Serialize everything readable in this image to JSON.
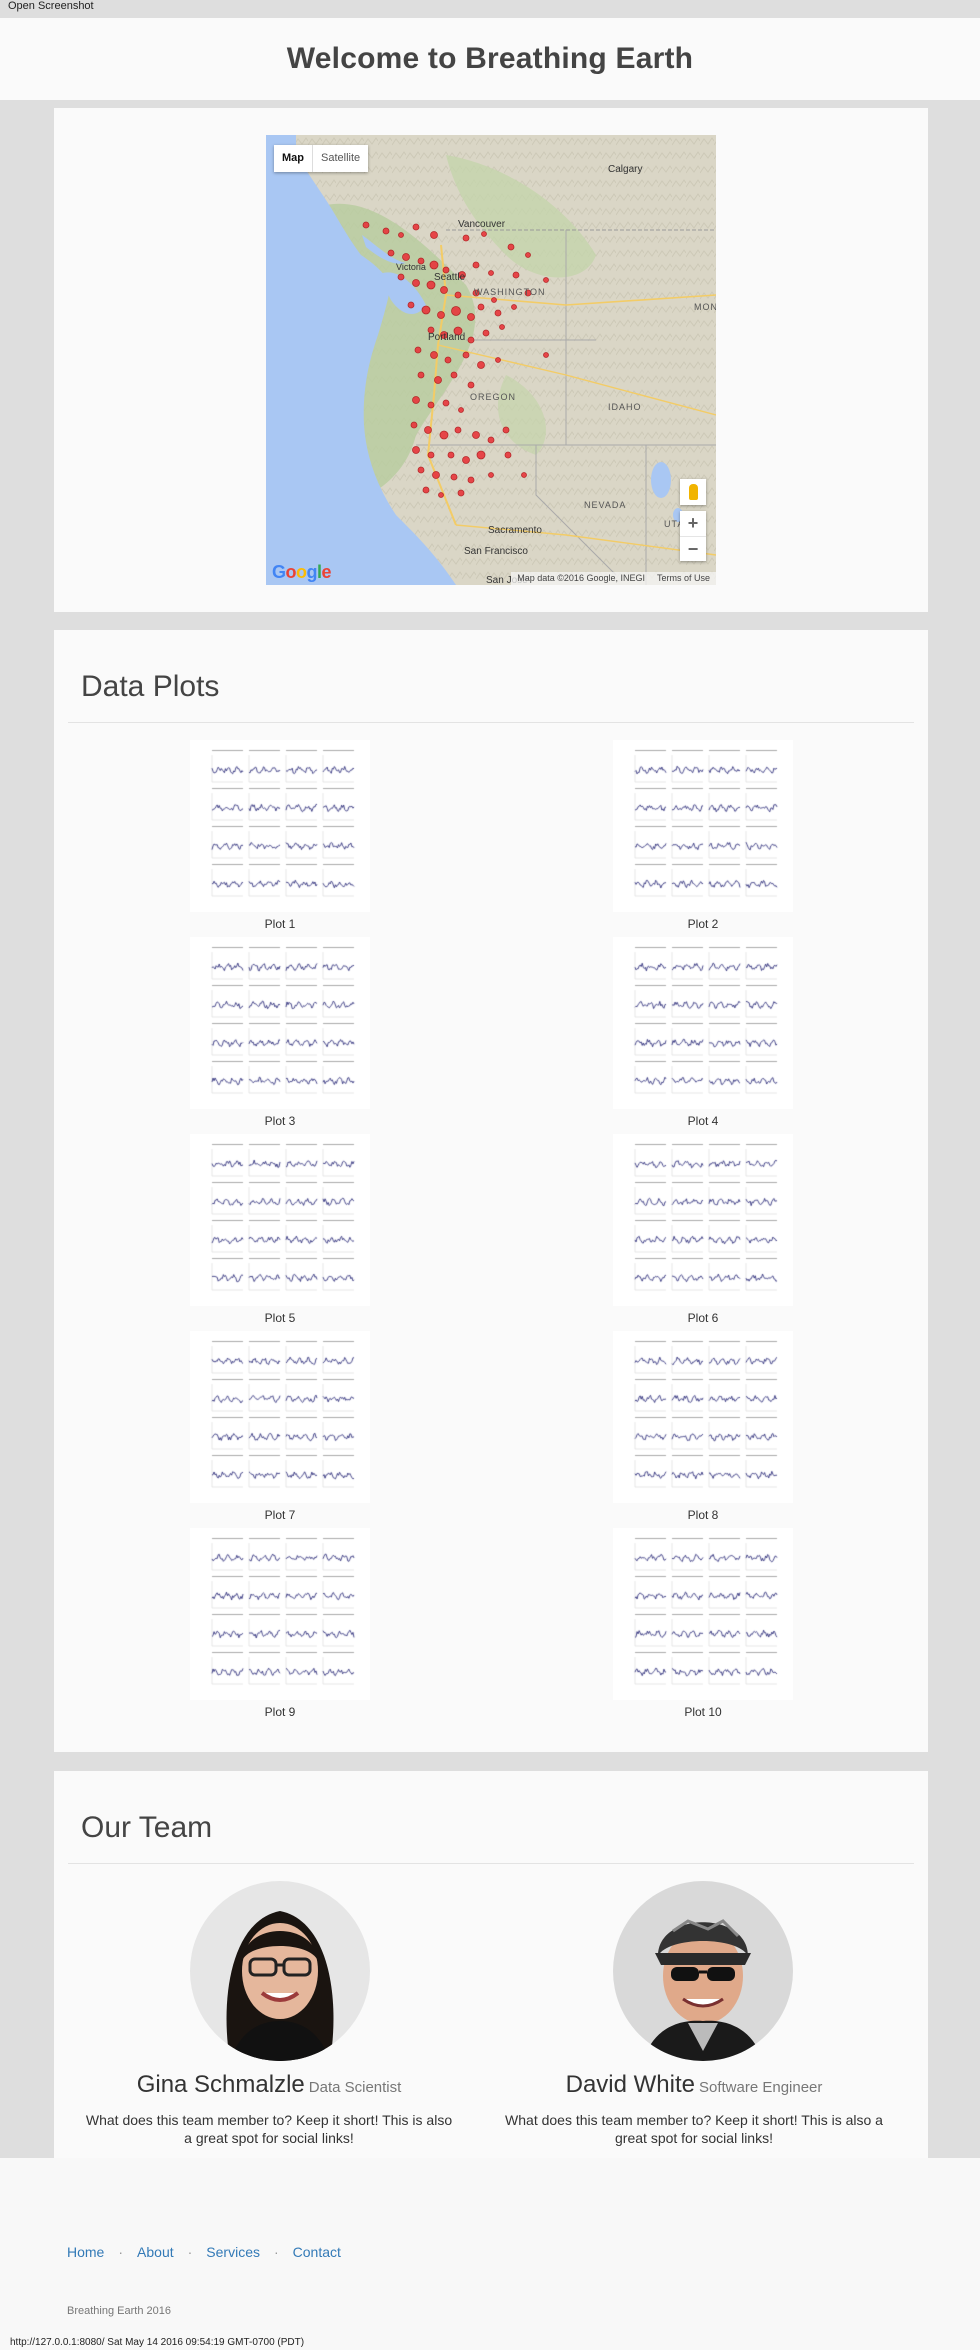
{
  "top_link": "Open Screenshot",
  "header": {
    "title": "Welcome to Breathing Earth"
  },
  "map": {
    "type_buttons": [
      "Map",
      "Satellite"
    ],
    "labels": [
      {
        "text": "Calgary"
      },
      {
        "text": "Vancouver"
      },
      {
        "text": "Victoria"
      },
      {
        "text": "Seattle"
      },
      {
        "text": "WASHINGTON"
      },
      {
        "text": "Portland"
      },
      {
        "text": "OREGON"
      },
      {
        "text": "IDAHO"
      },
      {
        "text": "NEVADA"
      },
      {
        "text": "MON"
      },
      {
        "text": "UTA"
      },
      {
        "text": "Sacramento"
      },
      {
        "text": "San Francisco"
      },
      {
        "text": "San Jose"
      }
    ],
    "zoom_in": "+",
    "zoom_out": "−",
    "logo": "Google",
    "attribution": "Map data ©2016 Google, INEGI",
    "terms": "Terms of Use",
    "colors": {
      "water": "#a9c7f3",
      "land": "#dad6c6",
      "marker": "#e8363b"
    }
  },
  "plots": {
    "title": "Data Plots",
    "items": [
      {
        "caption": "Plot 1"
      },
      {
        "caption": "Plot 2"
      },
      {
        "caption": "Plot 3"
      },
      {
        "caption": "Plot 4"
      },
      {
        "caption": "Plot 5"
      },
      {
        "caption": "Plot 6"
      },
      {
        "caption": "Plot 7"
      },
      {
        "caption": "Plot 8"
      },
      {
        "caption": "Plot 9"
      },
      {
        "caption": "Plot 10"
      }
    ]
  },
  "team": {
    "title": "Our Team",
    "members": [
      {
        "name": "Gina Schmalzle",
        "role": "Data Scientist",
        "text": "What does this team member to? Keep it short! This is also a great spot for social links!"
      },
      {
        "name": "David White",
        "role": "Software Engineer",
        "text": "What does this team member to? Keep it short! This is also a great spot for social links!"
      }
    ]
  },
  "footer": {
    "nav": [
      "Home",
      "About",
      "Services",
      "Contact"
    ],
    "copyright": "Breathing Earth 2016"
  },
  "status_bar": "http://127.0.0.1:8080/ Sat May 14 2016 09:54:19 GMT-0700 (PDT)"
}
